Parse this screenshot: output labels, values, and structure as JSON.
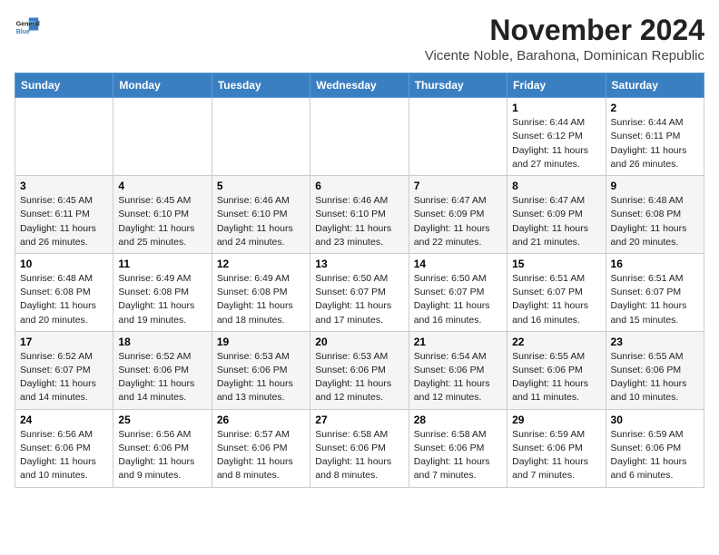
{
  "header": {
    "logo_line1": "General",
    "logo_line2": "Blue",
    "month": "November 2024",
    "location": "Vicente Noble, Barahona, Dominican Republic"
  },
  "weekdays": [
    "Sunday",
    "Monday",
    "Tuesday",
    "Wednesday",
    "Thursday",
    "Friday",
    "Saturday"
  ],
  "weeks": [
    [
      {
        "day": "",
        "info": ""
      },
      {
        "day": "",
        "info": ""
      },
      {
        "day": "",
        "info": ""
      },
      {
        "day": "",
        "info": ""
      },
      {
        "day": "",
        "info": ""
      },
      {
        "day": "1",
        "info": "Sunrise: 6:44 AM\nSunset: 6:12 PM\nDaylight: 11 hours and 27 minutes."
      },
      {
        "day": "2",
        "info": "Sunrise: 6:44 AM\nSunset: 6:11 PM\nDaylight: 11 hours and 26 minutes."
      }
    ],
    [
      {
        "day": "3",
        "info": "Sunrise: 6:45 AM\nSunset: 6:11 PM\nDaylight: 11 hours and 26 minutes."
      },
      {
        "day": "4",
        "info": "Sunrise: 6:45 AM\nSunset: 6:10 PM\nDaylight: 11 hours and 25 minutes."
      },
      {
        "day": "5",
        "info": "Sunrise: 6:46 AM\nSunset: 6:10 PM\nDaylight: 11 hours and 24 minutes."
      },
      {
        "day": "6",
        "info": "Sunrise: 6:46 AM\nSunset: 6:10 PM\nDaylight: 11 hours and 23 minutes."
      },
      {
        "day": "7",
        "info": "Sunrise: 6:47 AM\nSunset: 6:09 PM\nDaylight: 11 hours and 22 minutes."
      },
      {
        "day": "8",
        "info": "Sunrise: 6:47 AM\nSunset: 6:09 PM\nDaylight: 11 hours and 21 minutes."
      },
      {
        "day": "9",
        "info": "Sunrise: 6:48 AM\nSunset: 6:08 PM\nDaylight: 11 hours and 20 minutes."
      }
    ],
    [
      {
        "day": "10",
        "info": "Sunrise: 6:48 AM\nSunset: 6:08 PM\nDaylight: 11 hours and 20 minutes."
      },
      {
        "day": "11",
        "info": "Sunrise: 6:49 AM\nSunset: 6:08 PM\nDaylight: 11 hours and 19 minutes."
      },
      {
        "day": "12",
        "info": "Sunrise: 6:49 AM\nSunset: 6:08 PM\nDaylight: 11 hours and 18 minutes."
      },
      {
        "day": "13",
        "info": "Sunrise: 6:50 AM\nSunset: 6:07 PM\nDaylight: 11 hours and 17 minutes."
      },
      {
        "day": "14",
        "info": "Sunrise: 6:50 AM\nSunset: 6:07 PM\nDaylight: 11 hours and 16 minutes."
      },
      {
        "day": "15",
        "info": "Sunrise: 6:51 AM\nSunset: 6:07 PM\nDaylight: 11 hours and 16 minutes."
      },
      {
        "day": "16",
        "info": "Sunrise: 6:51 AM\nSunset: 6:07 PM\nDaylight: 11 hours and 15 minutes."
      }
    ],
    [
      {
        "day": "17",
        "info": "Sunrise: 6:52 AM\nSunset: 6:07 PM\nDaylight: 11 hours and 14 minutes."
      },
      {
        "day": "18",
        "info": "Sunrise: 6:52 AM\nSunset: 6:06 PM\nDaylight: 11 hours and 14 minutes."
      },
      {
        "day": "19",
        "info": "Sunrise: 6:53 AM\nSunset: 6:06 PM\nDaylight: 11 hours and 13 minutes."
      },
      {
        "day": "20",
        "info": "Sunrise: 6:53 AM\nSunset: 6:06 PM\nDaylight: 11 hours and 12 minutes."
      },
      {
        "day": "21",
        "info": "Sunrise: 6:54 AM\nSunset: 6:06 PM\nDaylight: 11 hours and 12 minutes."
      },
      {
        "day": "22",
        "info": "Sunrise: 6:55 AM\nSunset: 6:06 PM\nDaylight: 11 hours and 11 minutes."
      },
      {
        "day": "23",
        "info": "Sunrise: 6:55 AM\nSunset: 6:06 PM\nDaylight: 11 hours and 10 minutes."
      }
    ],
    [
      {
        "day": "24",
        "info": "Sunrise: 6:56 AM\nSunset: 6:06 PM\nDaylight: 11 hours and 10 minutes."
      },
      {
        "day": "25",
        "info": "Sunrise: 6:56 AM\nSunset: 6:06 PM\nDaylight: 11 hours and 9 minutes."
      },
      {
        "day": "26",
        "info": "Sunrise: 6:57 AM\nSunset: 6:06 PM\nDaylight: 11 hours and 8 minutes."
      },
      {
        "day": "27",
        "info": "Sunrise: 6:58 AM\nSunset: 6:06 PM\nDaylight: 11 hours and 8 minutes."
      },
      {
        "day": "28",
        "info": "Sunrise: 6:58 AM\nSunset: 6:06 PM\nDaylight: 11 hours and 7 minutes."
      },
      {
        "day": "29",
        "info": "Sunrise: 6:59 AM\nSunset: 6:06 PM\nDaylight: 11 hours and 7 minutes."
      },
      {
        "day": "30",
        "info": "Sunrise: 6:59 AM\nSunset: 6:06 PM\nDaylight: 11 hours and 6 minutes."
      }
    ]
  ]
}
